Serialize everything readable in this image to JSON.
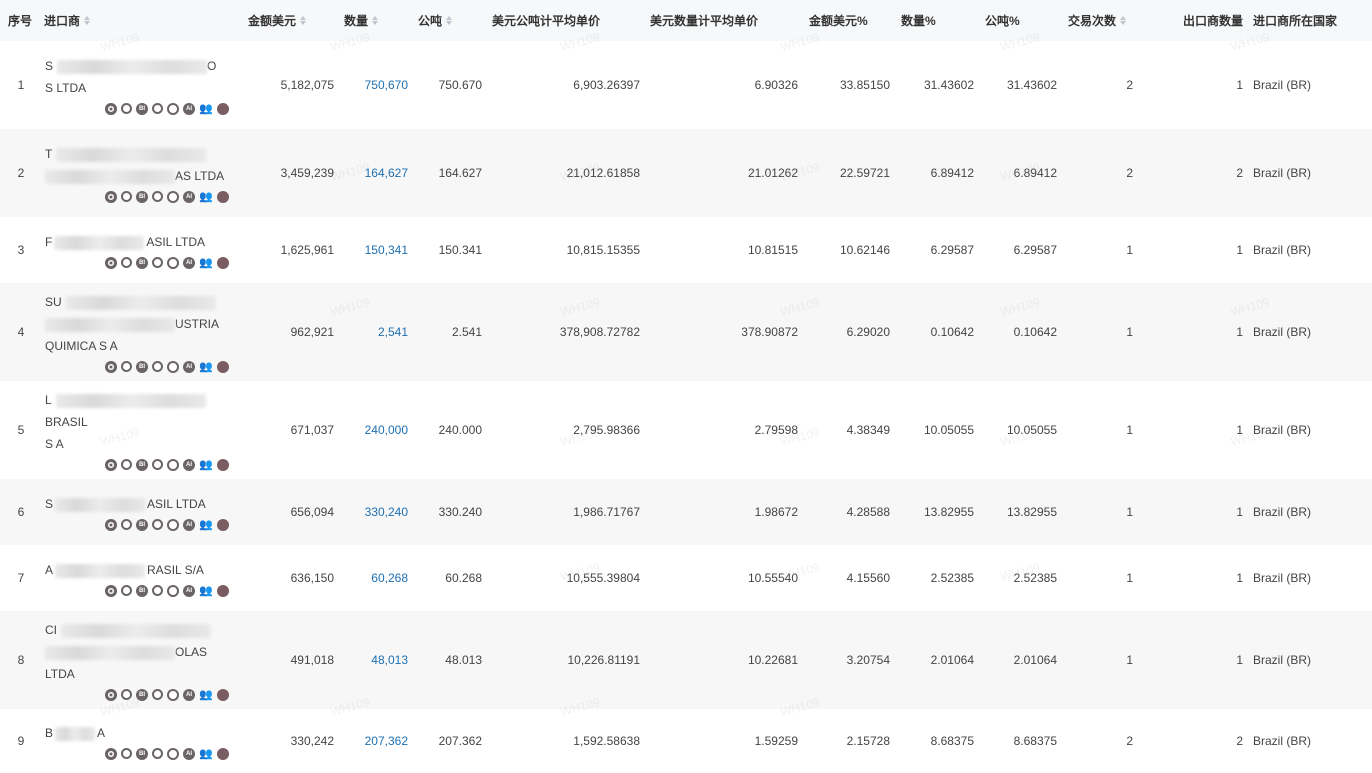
{
  "columns": {
    "index": "序号",
    "importer": "进口商",
    "amount_usd": "金额美元",
    "quantity": "数量",
    "tonnes": "公吨",
    "usd_per_tonne": "美元公吨计平均单价",
    "usd_per_qty": "美元数量计平均单价",
    "amount_pct": "金额美元%",
    "qty_pct": "数量%",
    "tonnes_pct": "公吨%",
    "trades": "交易次数",
    "exporters": "出口商数量",
    "country": "进口商所在国家"
  },
  "icons": [
    "target-icon",
    "compass-icon",
    "bi-icon",
    "circle-icon",
    "globe-icon",
    "ai-icon",
    "people-icon",
    "record-icon"
  ],
  "icon_labels": {
    "bi": "BI",
    "ai": "AI"
  },
  "watermark": "WH109",
  "rows": [
    {
      "index": "1",
      "name_lines": [
        "S",
        "O",
        "S LTDA"
      ],
      "amount_usd": "5,182,075",
      "quantity": "750,670",
      "tonnes": "750.670",
      "usd_per_tonne": "6,903.26397",
      "usd_per_qty": "6.90326",
      "amount_pct": "33.85150",
      "qty_pct": "31.43602",
      "tonnes_pct": "31.43602",
      "trades": "2",
      "exporters": "1",
      "country": "Brazil (BR)"
    },
    {
      "index": "2",
      "name_lines": [
        "T",
        "",
        "AS LTDA"
      ],
      "amount_usd": "3,459,239",
      "quantity": "164,627",
      "tonnes": "164.627",
      "usd_per_tonne": "21,012.61858",
      "usd_per_qty": "21.01262",
      "amount_pct": "22.59721",
      "qty_pct": "6.89412",
      "tonnes_pct": "6.89412",
      "trades": "2",
      "exporters": "2",
      "country": "Brazil (BR)"
    },
    {
      "index": "3",
      "name_lines": [
        "F",
        "ASIL LTDA"
      ],
      "amount_usd": "1,625,961",
      "quantity": "150,341",
      "tonnes": "150.341",
      "usd_per_tonne": "10,815.15355",
      "usd_per_qty": "10.81515",
      "amount_pct": "10.62146",
      "qty_pct": "6.29587",
      "tonnes_pct": "6.29587",
      "trades": "1",
      "exporters": "1",
      "country": "Brazil (BR)"
    },
    {
      "index": "4",
      "name_lines": [
        "SU",
        "",
        "USTRIA QUIMICA S A"
      ],
      "amount_usd": "962,921",
      "quantity": "2,541",
      "tonnes": "2.541",
      "usd_per_tonne": "378,908.72782",
      "usd_per_qty": "378.90872",
      "amount_pct": "6.29020",
      "qty_pct": "0.10642",
      "tonnes_pct": "0.10642",
      "trades": "1",
      "exporters": "1",
      "country": "Brazil (BR)"
    },
    {
      "index": "5",
      "name_lines": [
        "L",
        "BRASIL",
        "S A"
      ],
      "amount_usd": "671,037",
      "quantity": "240,000",
      "tonnes": "240.000",
      "usd_per_tonne": "2,795.98366",
      "usd_per_qty": "2.79598",
      "amount_pct": "4.38349",
      "qty_pct": "10.05055",
      "tonnes_pct": "10.05055",
      "trades": "1",
      "exporters": "1",
      "country": "Brazil (BR)"
    },
    {
      "index": "6",
      "name_lines": [
        "S",
        "ASIL LTDA"
      ],
      "amount_usd": "656,094",
      "quantity": "330,240",
      "tonnes": "330.240",
      "usd_per_tonne": "1,986.71767",
      "usd_per_qty": "1.98672",
      "amount_pct": "4.28588",
      "qty_pct": "13.82955",
      "tonnes_pct": "13.82955",
      "trades": "1",
      "exporters": "1",
      "country": "Brazil (BR)"
    },
    {
      "index": "7",
      "name_lines": [
        "A",
        "RASIL S/A"
      ],
      "amount_usd": "636,150",
      "quantity": "60,268",
      "tonnes": "60.268",
      "usd_per_tonne": "10,555.39804",
      "usd_per_qty": "10.55540",
      "amount_pct": "4.15560",
      "qty_pct": "2.52385",
      "tonnes_pct": "2.52385",
      "trades": "1",
      "exporters": "1",
      "country": "Brazil (BR)"
    },
    {
      "index": "8",
      "name_lines": [
        "CI",
        "",
        "OLAS LTDA"
      ],
      "amount_usd": "491,018",
      "quantity": "48,013",
      "tonnes": "48.013",
      "usd_per_tonne": "10,226.81191",
      "usd_per_qty": "10.22681",
      "amount_pct": "3.20754",
      "qty_pct": "2.01064",
      "tonnes_pct": "2.01064",
      "trades": "1",
      "exporters": "1",
      "country": "Brazil (BR)"
    },
    {
      "index": "9",
      "name_lines": [
        "B",
        "A"
      ],
      "amount_usd": "330,242",
      "quantity": "207,362",
      "tonnes": "207.362",
      "usd_per_tonne": "1,592.58638",
      "usd_per_qty": "1.59259",
      "amount_pct": "2.15728",
      "qty_pct": "8.68375",
      "tonnes_pct": "8.68375",
      "trades": "2",
      "exporters": "2",
      "country": "Brazil (BR)"
    }
  ]
}
